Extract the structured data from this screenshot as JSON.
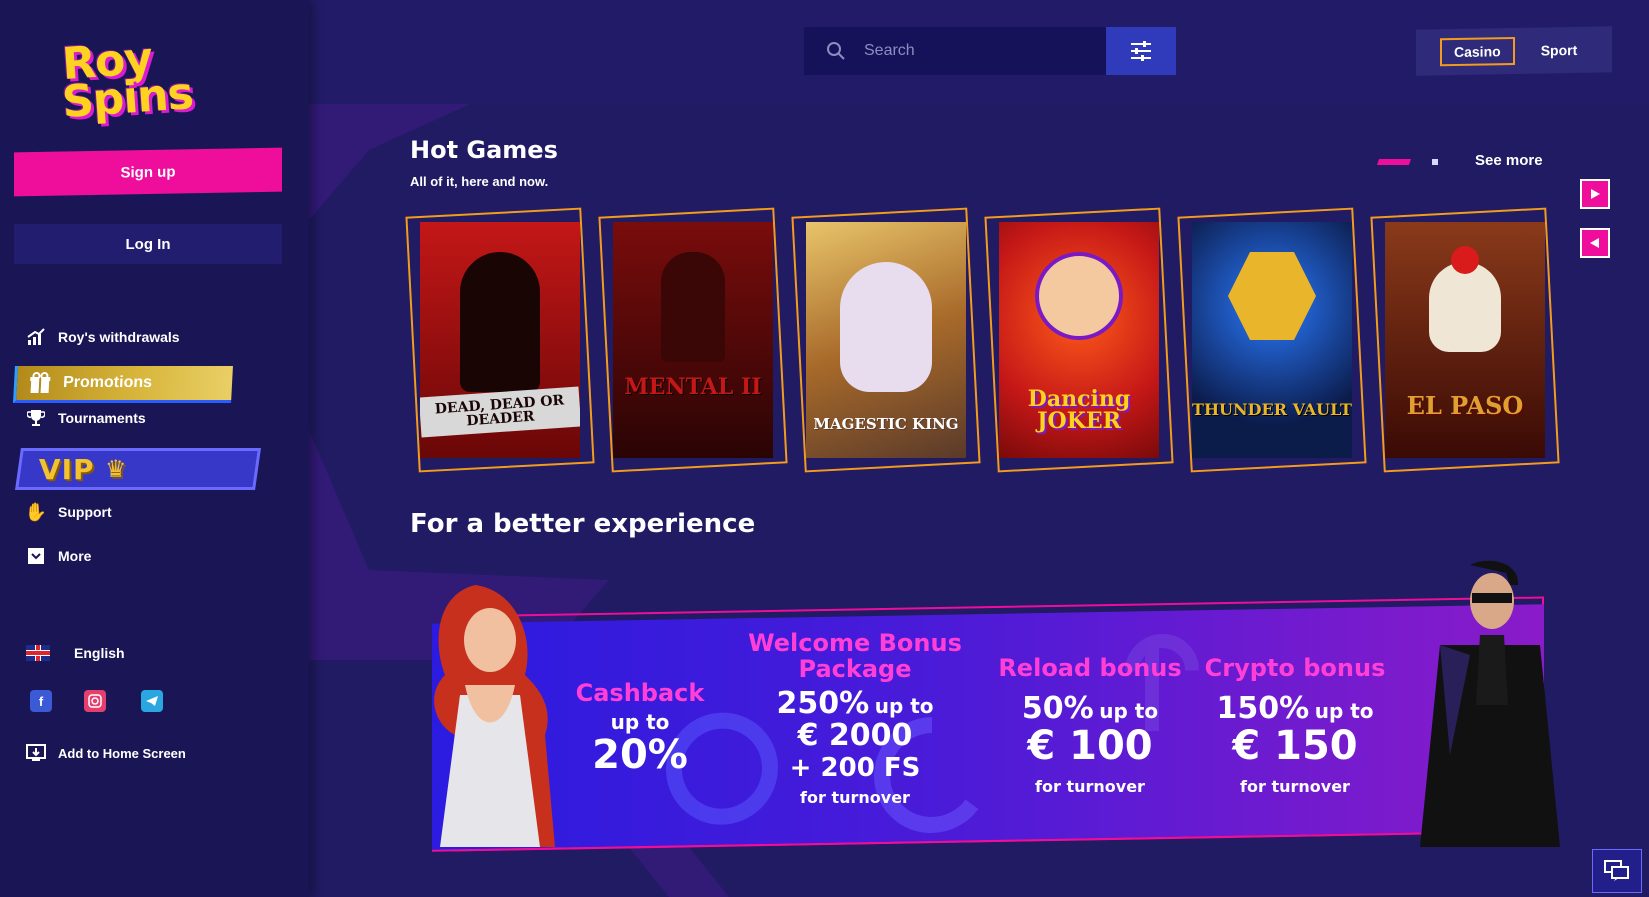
{
  "brand": {
    "logo_line1": "Roy",
    "logo_line2": "Spins"
  },
  "auth": {
    "signup_label": "Sign up",
    "login_label": "Log In"
  },
  "sidebar": {
    "items": [
      {
        "label": "Roy's withdrawals",
        "icon": "chart-icon"
      },
      {
        "label": "Promotions",
        "icon": "gift-icon"
      },
      {
        "label": "Tournaments",
        "icon": "trophy-icon"
      },
      {
        "label": "VIP",
        "icon": "crown-icon"
      },
      {
        "label": "Support",
        "icon": "hand-icon"
      },
      {
        "label": "More",
        "icon": "chevron-down-icon"
      }
    ],
    "language": "English",
    "socials": [
      "facebook-icon",
      "instagram-icon",
      "telegram-icon"
    ],
    "add_home": "Add to Home Screen"
  },
  "topbar": {
    "search_placeholder": "Search",
    "switch": {
      "casino": "Casino",
      "sport": "Sport"
    }
  },
  "hot_games": {
    "title": "Hot Games",
    "subtitle": "All of it, here and now.",
    "see_more": "See more",
    "games": [
      {
        "name": "DEAD, DEAD OR DEADER",
        "bg": "#8a0d0d"
      },
      {
        "name": "MENTAL II",
        "bg": "#5a0b0b"
      },
      {
        "name": "MAGESTIC KING",
        "bg": "#b88a3a"
      },
      {
        "name": "Dancing JOKER",
        "bg": "#c6172a"
      },
      {
        "name": "THUNDER VAULT",
        "bg": "#0b1b4a"
      },
      {
        "name": "EL PASO",
        "bg": "#5a1a0a"
      }
    ]
  },
  "experience": {
    "title": "For a better experience",
    "promos": {
      "cashback": {
        "title": "Cashback",
        "upto": "up to",
        "value": "20%"
      },
      "welcome": {
        "title_line1": "Welcome Bonus",
        "title_line2": "Package",
        "line1_value": "250%",
        "line1_upto": "up to",
        "line2": "€ 2000",
        "line3": "+ 200 FS",
        "turnover": "for turnover"
      },
      "reload": {
        "title": "Reload bonus",
        "value": "50%",
        "upto": "up to",
        "amount": "€ 100",
        "turnover": "for turnover"
      },
      "crypto": {
        "title": "Crypto bonus",
        "value": "150%",
        "upto": "up to",
        "amount": "€ 150",
        "turnover": "for turnover"
      }
    }
  },
  "colors": {
    "accent": "#ee0e9b",
    "gold": "#f29b1e",
    "bg": "#201b63",
    "sidebar": "#1a1656"
  }
}
